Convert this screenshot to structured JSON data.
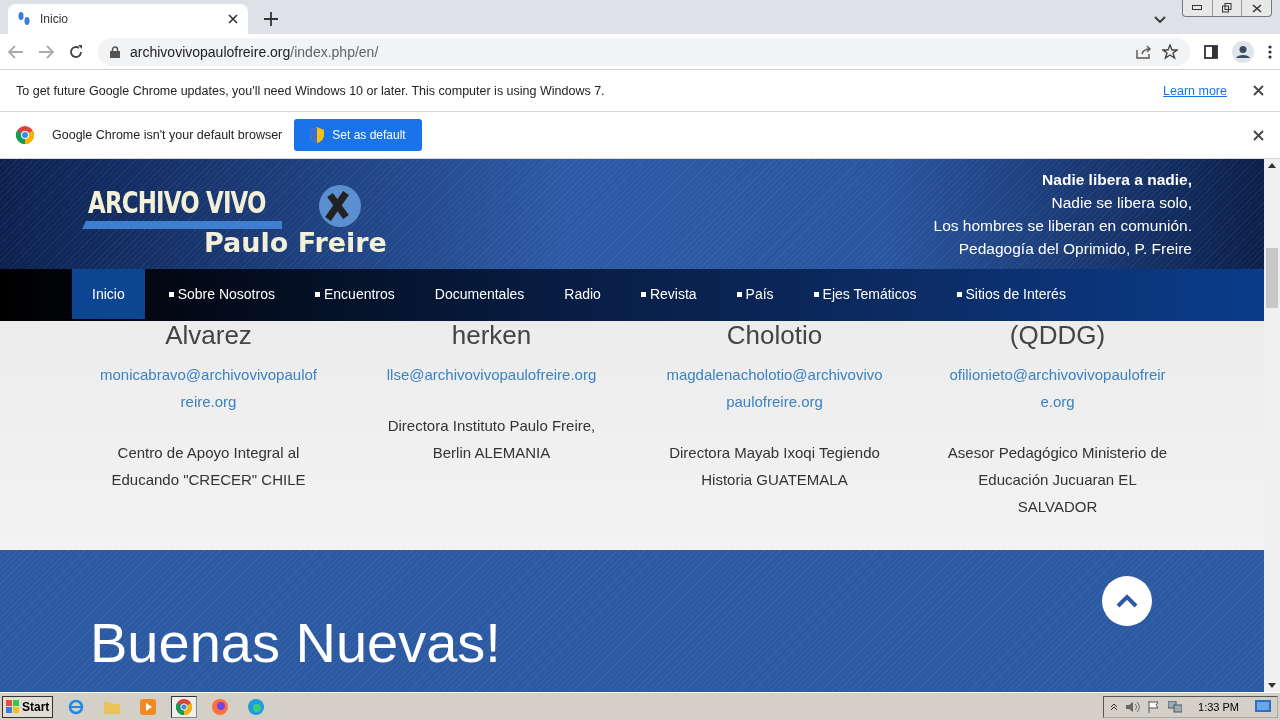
{
  "browser": {
    "tab": {
      "title": "Inicio",
      "selected": true
    },
    "url": {
      "host": "archivovivopaulofreire.org",
      "path": "/index.php/en/"
    }
  },
  "infobars": [
    {
      "kind": "update",
      "text": "To get future Google Chrome updates, you'll need Windows 10 or later. This computer is using Windows 7.",
      "link": "Learn more"
    },
    {
      "kind": "default",
      "text": "Google Chrome isn't your default browser",
      "button": "Set as default"
    }
  ],
  "site": {
    "logo": {
      "line_1": "ARCHIVO VIVO",
      "line_2": "Paulo Freire"
    },
    "quote": [
      "Nadie libera a nadie,",
      "Nadie se libera solo,",
      "Los hombres se liberan en comunión.",
      "Pedagogía del Oprimido,  P. Freire"
    ],
    "nav": [
      {
        "label": "Inicio",
        "selected": true,
        "bullet": false
      },
      {
        "label": "Sobre Nosotros",
        "selected": false,
        "bullet": true
      },
      {
        "label": "Encuentros",
        "selected": false,
        "bullet": true
      },
      {
        "label": "Documentales",
        "selected": false,
        "bullet": false
      },
      {
        "label": "Radio",
        "selected": false,
        "bullet": false
      },
      {
        "label": "Revista",
        "selected": false,
        "bullet": true
      },
      {
        "label": "País",
        "selected": false,
        "bullet": true
      },
      {
        "label": "Ejes Temáticos",
        "selected": false,
        "bullet": true
      },
      {
        "label": "Sitios de Interés",
        "selected": false,
        "bullet": true
      }
    ],
    "people": [
      {
        "name": "Alvarez",
        "email": "monicabravo@archivovivopaulofreire.org",
        "role": "Centro de Apoyo Integral al Educando \"CRECER\" CHILE"
      },
      {
        "name": "herken",
        "email": "llse@archivovivopaulofreire.org",
        "role": "Directora Instituto Paulo Freire, Berlin ALEMANIA"
      },
      {
        "name": "Cholotio",
        "email": "magdalenacholotio@archivovivopaulofreire.org",
        "role": "Directora Mayab Ixoqi Tegiendo Historia GUATEMALA"
      },
      {
        "name": "(QDDG)",
        "email": "ofilionieto@archivovivopaulofreire.org",
        "role": "Asesor Pedagógico Ministerio de Educación Jucuaran EL SALVADOR"
      }
    ],
    "section_title": "Buenas Nuevas!"
  },
  "taskbar": {
    "start": "Start",
    "clock": "1:33 PM"
  }
}
